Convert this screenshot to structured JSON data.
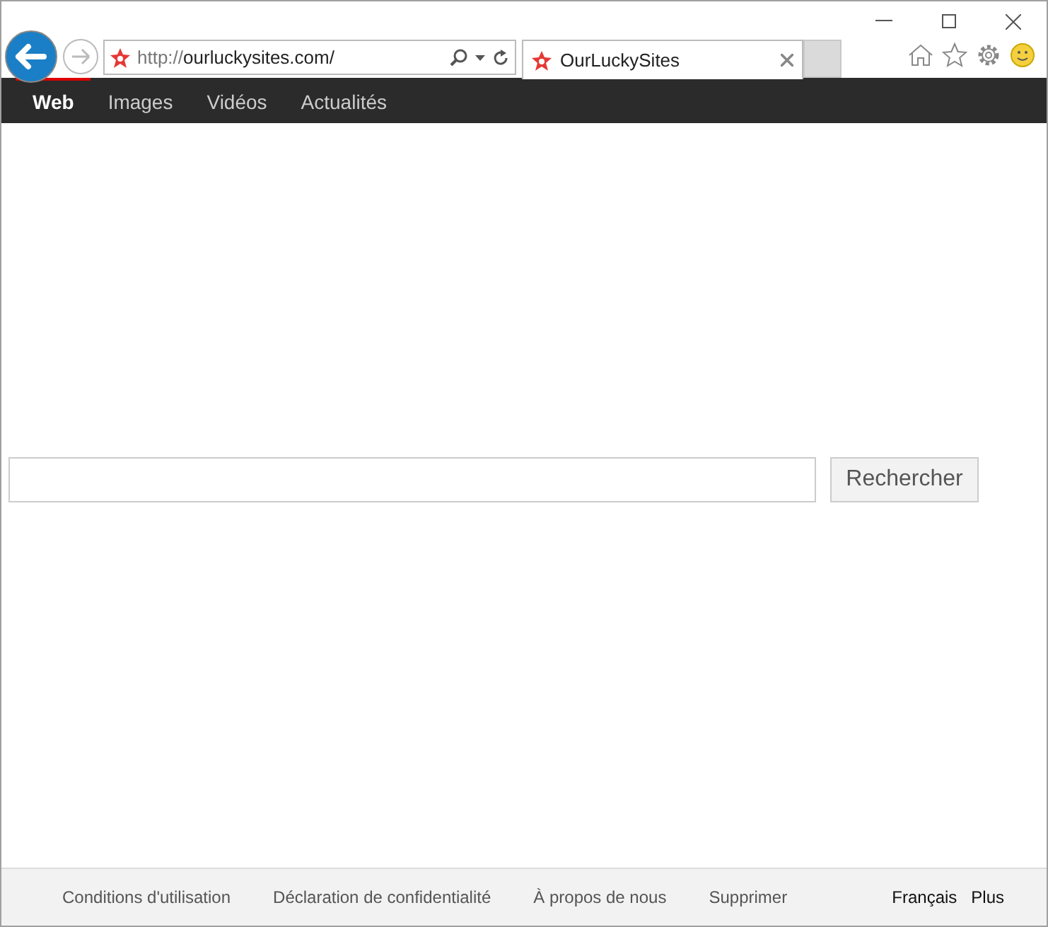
{
  "address_bar": {
    "scheme": "http://",
    "host": "ourluckysites.com/"
  },
  "tabs": [
    {
      "label": "OurLuckySites",
      "selected": true
    }
  ],
  "nav": [
    {
      "label": "Web",
      "selected": true
    },
    {
      "label": "Images",
      "selected": false
    },
    {
      "label": "Vidéos",
      "selected": false
    },
    {
      "label": "Actualités",
      "selected": false
    }
  ],
  "search": {
    "button": "Rechercher"
  },
  "footer": {
    "links": [
      "Conditions d'utilisation",
      "Déclaration de confidentialité",
      "À propos de nous",
      "Supprimer"
    ],
    "right": [
      "Français",
      "Plus"
    ]
  }
}
